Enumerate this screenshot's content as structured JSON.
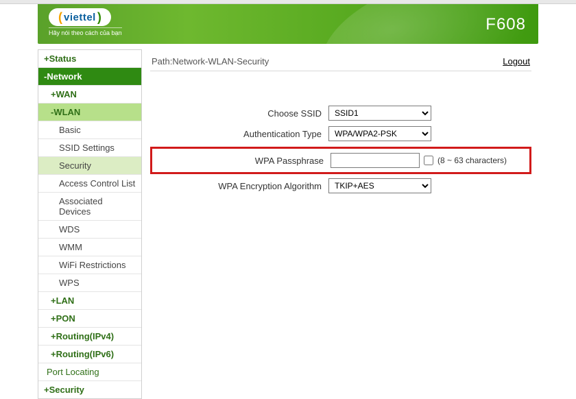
{
  "header": {
    "brand": "viettel",
    "tagline": "Hãy nói theo cách của bạn",
    "model": "F608"
  },
  "path": {
    "prefix": "Path:",
    "value": "Network-WLAN-Security",
    "logout": "Logout"
  },
  "sidebar": {
    "status": "+Status",
    "network": "-Network",
    "wan": "+WAN",
    "wlan": "-WLAN",
    "wlan_items": {
      "basic": "Basic",
      "ssid": "SSID Settings",
      "security": "Security",
      "acl": "Access Control List",
      "assoc": "Associated Devices",
      "wds": "WDS",
      "wmm": "WMM",
      "wifir": "WiFi Restrictions",
      "wps": "WPS"
    },
    "lan": "+LAN",
    "pon": "+PON",
    "r4": "+Routing(IPv4)",
    "r6": "+Routing(IPv6)",
    "port": "Port Locating",
    "security": "+Security"
  },
  "form": {
    "choose_ssid_label": "Choose SSID",
    "choose_ssid_value": "SSID1",
    "auth_type_label": "Authentication Type",
    "auth_type_value": "WPA/WPA2-PSK",
    "wpa_pass_label": "WPA Passphrase",
    "wpa_pass_value": "",
    "wpa_pass_hint": "(8 ~ 63 characters)",
    "wpa_algo_label": "WPA Encryption Algorithm",
    "wpa_algo_value": "TKIP+AES"
  }
}
